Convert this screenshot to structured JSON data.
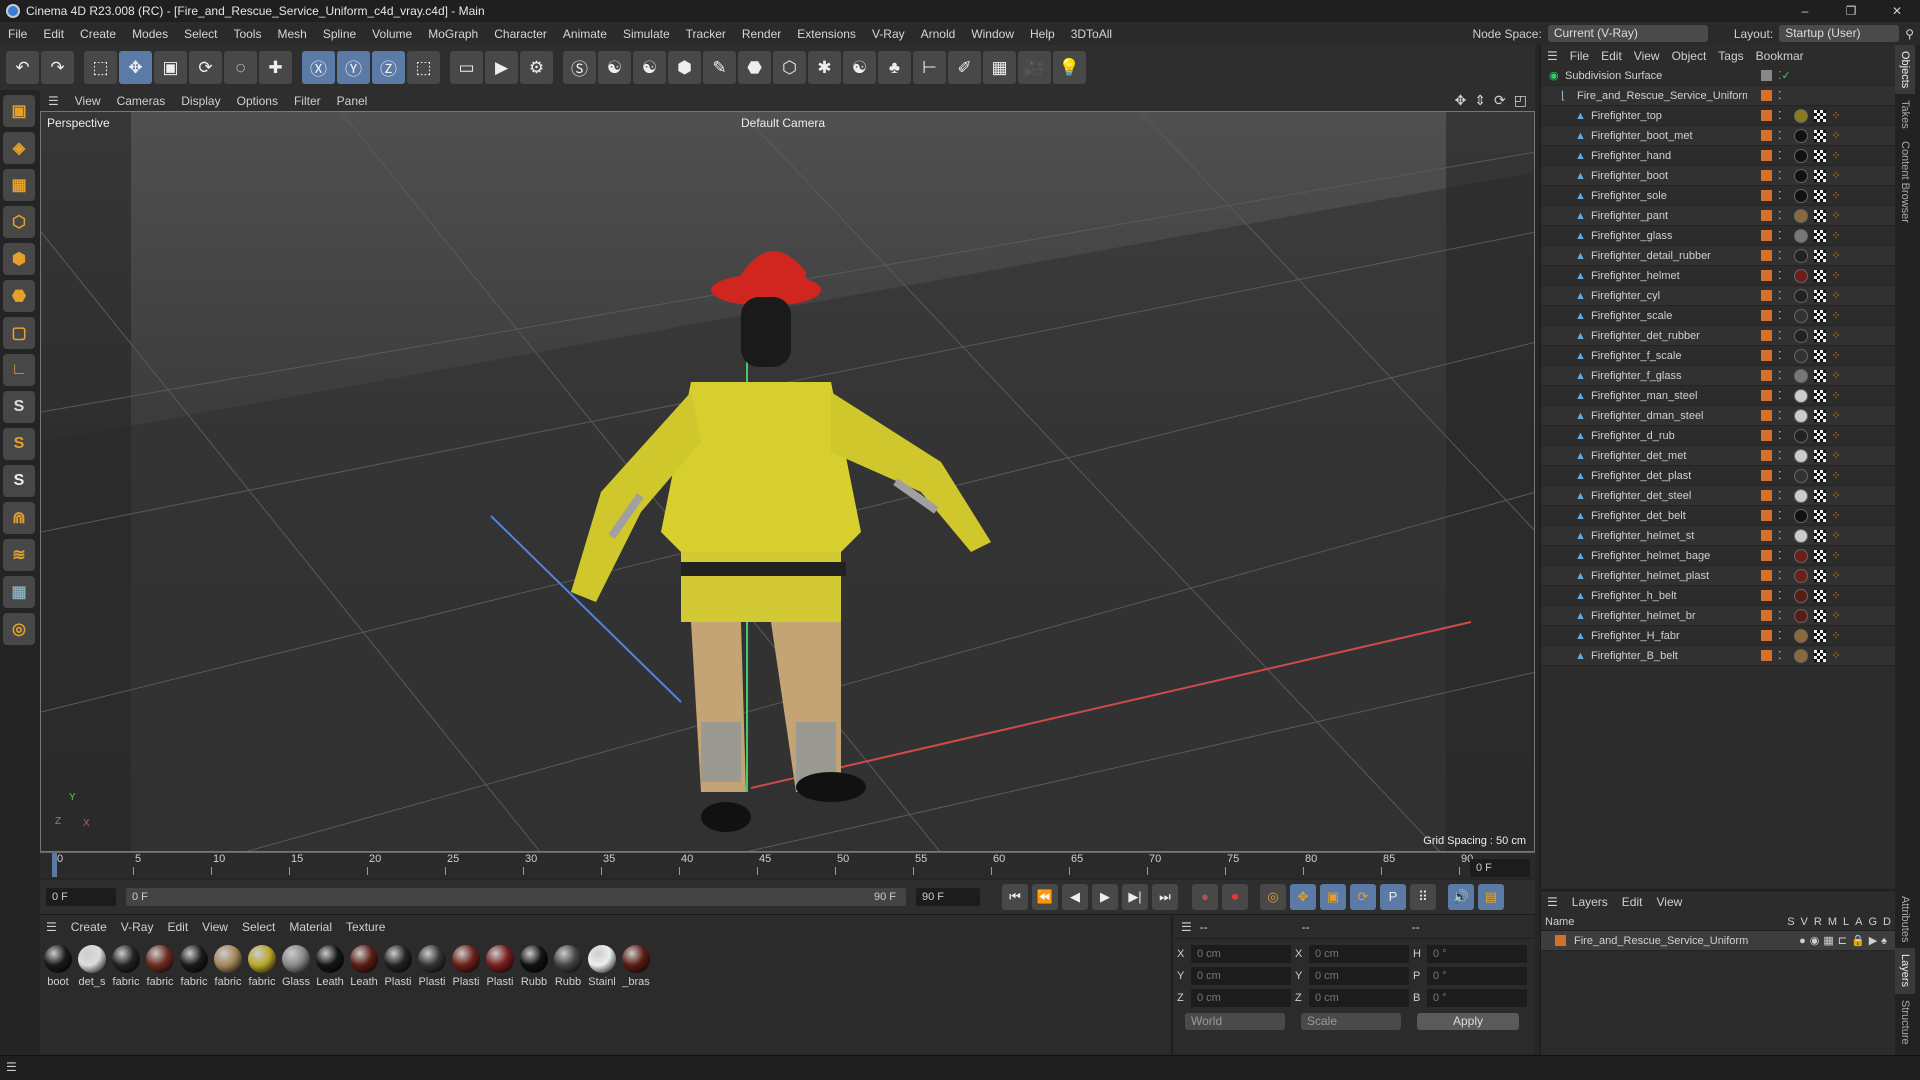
{
  "title": "Cinema 4D R23.008 (RC) - [Fire_and_Rescue_Service_Uniform_c4d_vray.c4d] - Main",
  "window_controls": [
    "–",
    "❐",
    "✕"
  ],
  "menu": [
    "File",
    "Edit",
    "Create",
    "Modes",
    "Select",
    "Tools",
    "Mesh",
    "Spline",
    "Volume",
    "MoGraph",
    "Character",
    "Animate",
    "Simulate",
    "Tracker",
    "Render",
    "Extensions",
    "V-Ray",
    "Arnold",
    "Window",
    "Help",
    "3DToAll"
  ],
  "node_space": {
    "label": "Node Space:",
    "value": "Current (V-Ray)"
  },
  "layout": {
    "label": "Layout:",
    "value": "Startup (User)"
  },
  "toolbar_icons": [
    "undo",
    "redo",
    "select",
    "move",
    "scale",
    "rotate",
    "live-select",
    "add",
    "x-axis",
    "y-axis",
    "z-axis",
    "coord-system",
    "render-view",
    "render",
    "render-settings",
    "vray",
    "python1",
    "python2",
    "cube",
    "pen",
    "subdivision",
    "extrude",
    "gear",
    "python3",
    "cloner",
    "deformer",
    "sketch",
    "floor",
    "camera",
    "light"
  ],
  "viewport": {
    "menu": [
      "View",
      "Cameras",
      "Display",
      "Options",
      "Filter",
      "Panel"
    ],
    "label": "Perspective",
    "camera": "Default Camera",
    "grid_spacing": "Grid Spacing : 50 cm",
    "axis": [
      "Y",
      "Z",
      "X"
    ]
  },
  "timeline": {
    "ticks": [
      "0",
      "5",
      "10",
      "15",
      "20",
      "25",
      "30",
      "35",
      "40",
      "45",
      "50",
      "55",
      "60",
      "65",
      "70",
      "75",
      "80",
      "85",
      "90"
    ],
    "current": "0 F",
    "end_field": "0 F",
    "start": "0 F",
    "range_start": "0 F",
    "range_end": "90 F",
    "max": "90 F"
  },
  "materials": {
    "menu": [
      "Create",
      "V-Ray",
      "Edit",
      "View",
      "Select",
      "Material",
      "Texture"
    ],
    "items": [
      {
        "name": "boot",
        "color": "#1a1a1a"
      },
      {
        "name": "det_s",
        "color": "#ddd"
      },
      {
        "name": "fabric",
        "color": "#222"
      },
      {
        "name": "fabric",
        "color": "#6b2b1f"
      },
      {
        "name": "fabric",
        "color": "#1a1a1a"
      },
      {
        "name": "fabric",
        "color": "#a3875a"
      },
      {
        "name": "fabric",
        "color": "#b8a82a"
      },
      {
        "name": "Glass",
        "color": "#888"
      },
      {
        "name": "Leath",
        "color": "#151515"
      },
      {
        "name": "Leath",
        "color": "#5a1d14"
      },
      {
        "name": "Plasti",
        "color": "#222"
      },
      {
        "name": "Plasti",
        "color": "#333"
      },
      {
        "name": "Plasti",
        "color": "#6b1f1a"
      },
      {
        "name": "Plasti",
        "color": "#7a1e1e"
      },
      {
        "name": "Rubb",
        "color": "#111"
      },
      {
        "name": "Rubb",
        "color": "#444"
      },
      {
        "name": "Stainl",
        "color": "#eee"
      },
      {
        "name": "_bras",
        "color": "#5a1d14"
      }
    ]
  },
  "coords": {
    "headers": [
      "--",
      "--",
      "--"
    ],
    "rows": [
      {
        "a": "X",
        "av": "0 cm",
        "b": "X",
        "bv": "0 cm",
        "c": "H",
        "cv": "0 °"
      },
      {
        "a": "Y",
        "av": "0 cm",
        "b": "Y",
        "bv": "0 cm",
        "c": "P",
        "cv": "0 °"
      },
      {
        "a": "Z",
        "av": "0 cm",
        "b": "Z",
        "bv": "0 cm",
        "c": "B",
        "cv": "0 °"
      }
    ],
    "mode": "World",
    "type": "Scale",
    "apply": "Apply"
  },
  "objects": {
    "menu": [
      "File",
      "Edit",
      "View",
      "Object",
      "Tags",
      "Bookmar"
    ],
    "root": "Subdivision Surface",
    "group": "Fire_and_Rescue_Service_Uniform",
    "items": [
      {
        "name": "Firefighter_top",
        "mat": "#8a7a20"
      },
      {
        "name": "Firefighter_boot_met",
        "mat": "#111"
      },
      {
        "name": "Firefighter_hand",
        "mat": "#111"
      },
      {
        "name": "Firefighter_boot",
        "mat": "#111"
      },
      {
        "name": "Firefighter_sole",
        "mat": "#111"
      },
      {
        "name": "Firefighter_pant",
        "mat": "#8a6a3a"
      },
      {
        "name": "Firefighter_glass",
        "mat": "#777"
      },
      {
        "name": "Firefighter_detail_rubber",
        "mat": "#222"
      },
      {
        "name": "Firefighter_helmet",
        "mat": "#6b1f1a"
      },
      {
        "name": "Firefighter_cyl",
        "mat": "#222"
      },
      {
        "name": "Firefighter_scale",
        "mat": "#333"
      },
      {
        "name": "Firefighter_det_rubber",
        "mat": "#222"
      },
      {
        "name": "Firefighter_f_scale",
        "mat": "#333"
      },
      {
        "name": "Firefighter_f_glass",
        "mat": "#777"
      },
      {
        "name": "Firefighter_man_steel",
        "mat": "#ccc"
      },
      {
        "name": "Firefighter_dman_steel",
        "mat": "#ccc"
      },
      {
        "name": "Firefighter_d_rub",
        "mat": "#222"
      },
      {
        "name": "Firefighter_det_met",
        "mat": "#ccc"
      },
      {
        "name": "Firefighter_det_plast",
        "mat": "#333"
      },
      {
        "name": "Firefighter_det_steel",
        "mat": "#ccc"
      },
      {
        "name": "Firefighter_det_belt",
        "mat": "#111"
      },
      {
        "name": "Firefighter_helmet_st",
        "mat": "#ccc"
      },
      {
        "name": "Firefighter_helmet_bage",
        "mat": "#6b1f1a"
      },
      {
        "name": "Firefighter_helmet_plast",
        "mat": "#6b1f1a"
      },
      {
        "name": "Firefighter_h_belt",
        "mat": "#5a1d14"
      },
      {
        "name": "Firefighter_helmet_br",
        "mat": "#5a1d14"
      },
      {
        "name": "Firefighter_H_fabr",
        "mat": "#8a6a3a"
      },
      {
        "name": "Firefighter_B_belt",
        "mat": "#8a6a3a"
      }
    ]
  },
  "layers": {
    "menu": [
      "Layers",
      "Edit",
      "View"
    ],
    "name_header": "Name",
    "flags": [
      "S",
      "V",
      "R",
      "M",
      "L",
      "A",
      "G",
      "D"
    ],
    "items": [
      {
        "name": "Fire_and_Rescue_Service_Uniform",
        "color": "#d4702a"
      }
    ]
  },
  "side_tabs": [
    "Objects",
    "Takes",
    "Content Browser"
  ],
  "side_tabs_bottom": [
    "Attributes",
    "Layers",
    "Structure"
  ],
  "colors": {
    "accent": "#d4702a",
    "select": "#5c7aa6"
  }
}
